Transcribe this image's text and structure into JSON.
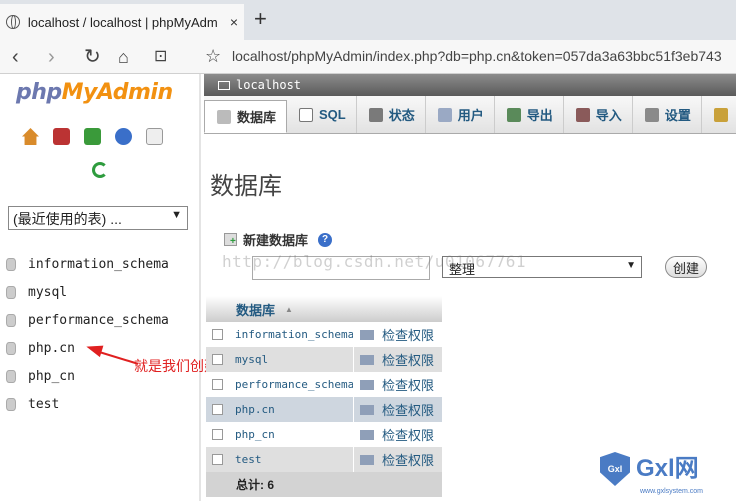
{
  "browser": {
    "tab_title": "localhost / localhost | phpMyAdm",
    "tab_close": "×",
    "new_tab": "+",
    "url": "localhost/phpMyAdmin/index.php?db=php.cn&token=057da3a63bbc51f3eb743",
    "back": "‹",
    "forward": "›",
    "reload": "↻",
    "home": "⌂",
    "reading": "⊡",
    "bookmark": "☆"
  },
  "sidebar": {
    "logo_php": "php",
    "logo_myadmin": "MyAdmin",
    "recent_select": "(最近使用的表) ...",
    "databases": [
      "information_schema",
      "mysql",
      "performance_schema",
      "php.cn",
      "php_cn",
      "test"
    ]
  },
  "annotation": {
    "text": "就是我们创建的数据库",
    "color": "#e02020"
  },
  "main": {
    "server": "localhost",
    "tabs": [
      {
        "label": "数据库",
        "icon": "database-icon"
      },
      {
        "label": "SQL",
        "icon": "sql-icon"
      },
      {
        "label": "状态",
        "icon": "status-icon"
      },
      {
        "label": "用户",
        "icon": "users-icon"
      },
      {
        "label": "导出",
        "icon": "export-icon"
      },
      {
        "label": "导入",
        "icon": "import-icon"
      },
      {
        "label": "设置",
        "icon": "settings-icon"
      }
    ],
    "page_title": "数据库",
    "new_db_label": "新建数据库",
    "collation_value": "整理",
    "create_button": "创建",
    "watermark": "http://blog.csdn.net/u01067761",
    "table": {
      "header": "数据库",
      "rows": [
        {
          "name": "information_schema",
          "privs": "检查权限"
        },
        {
          "name": "mysql",
          "privs": "检查权限"
        },
        {
          "name": "performance_schema",
          "privs": "检查权限"
        },
        {
          "name": "php.cn",
          "privs": "检查权限"
        },
        {
          "name": "php_cn",
          "privs": "检查权限"
        },
        {
          "name": "test",
          "privs": "检查权限"
        }
      ],
      "total": "总计: 6"
    }
  },
  "footer_logo": {
    "shield": "Gxl",
    "text": "Gxl网",
    "site": "www.gxlsystem.com"
  },
  "colors": {
    "link": "#235a81",
    "logo_php": "#6c78af",
    "logo_myadmin": "#f29111"
  }
}
